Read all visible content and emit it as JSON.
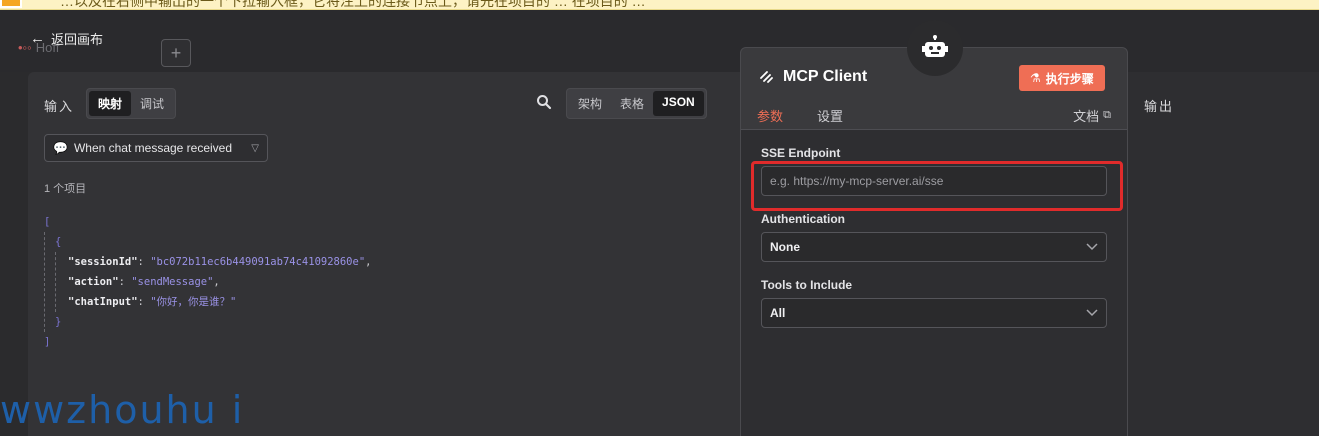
{
  "banner": {
    "text": "…以及在右侧中输出的一个下拉输入框，它将注上的连接节点上，请先在项目的 … 在项目的 …"
  },
  "canvas": {
    "back_label": "返回画布",
    "ghost_label": "Hoff",
    "add_symbol": "+"
  },
  "input_panel": {
    "title": "输入",
    "mode_tabs": [
      "映射",
      "调试"
    ],
    "view_tabs": [
      "架构",
      "表格",
      "JSON"
    ],
    "trigger_select": "When chat message received",
    "item_count": "1 个项目",
    "json": {
      "open_bracket": "[",
      "open_brace": "{",
      "fields": [
        {
          "key": "\"sessionId\"",
          "value": "\"bc072b11ec6b449091ab74c41092860e\"",
          "comma": ","
        },
        {
          "key": "\"action\"",
          "value": "\"sendMessage\"",
          "comma": ","
        },
        {
          "key": "\"chatInput\"",
          "value": "\"你好，你是谁？\"",
          "comma": ""
        }
      ],
      "close_brace": "}",
      "close_bracket": "]"
    }
  },
  "output_panel": {
    "title": "输出"
  },
  "node": {
    "title": "MCP Client",
    "execute_label": "执行步骤",
    "tabs": [
      "参数",
      "设置"
    ],
    "docs_label": "文档",
    "sse_label": "SSE Endpoint",
    "sse_placeholder": "e.g. https://my-mcp-server.ai/sse",
    "auth_label": "Authentication",
    "auth_value": "None",
    "tools_label": "Tools to Include",
    "tools_value": "All"
  },
  "watermark": "wwzhouhu i",
  "colors": {
    "accent": "#ef6e55",
    "highlight": "#e02b2b",
    "json_value": "#9a92e6"
  }
}
